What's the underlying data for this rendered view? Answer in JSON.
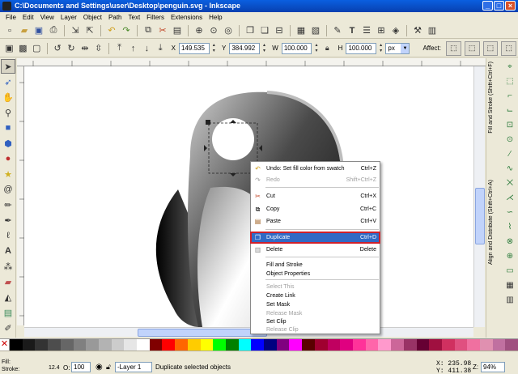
{
  "window": {
    "title": "C:\\Documents and Settings\\user\\Desktop\\penguin.svg - Inkscape"
  },
  "menubar": [
    "File",
    "Edit",
    "View",
    "Layer",
    "Object",
    "Path",
    "Text",
    "Filters",
    "Extensions",
    "Help"
  ],
  "toolbar1": {
    "icons": [
      "new-document-icon",
      "open-icon",
      "save-icon",
      "print-icon",
      "import-icon",
      "export-icon",
      "undo-icon",
      "redo-icon",
      "copy-icon",
      "cut-icon",
      "paste-icon",
      "zoom-selection-icon",
      "zoom-drawing-icon",
      "zoom-page-icon",
      "duplicate-icon",
      "clone-icon",
      "unlink-clone-icon",
      "group-icon",
      "ungroup-icon",
      "fill-stroke-icon",
      "text-tool-icon",
      "layers-icon",
      "align-icon",
      "xml-editor-icon",
      "preferences-icon",
      "document-properties-icon"
    ]
  },
  "toolbar2": {
    "x_label": "X",
    "x_value": "149.535",
    "y_label": "Y",
    "y_value": "384.992",
    "w_label": "W",
    "w_value": "100.000",
    "h_label": "H",
    "h_value": "100.000",
    "unit": "px",
    "affect_label": "Affect:"
  },
  "context_menu": {
    "items": [
      {
        "label": "Undo: Set fill color from swatch",
        "shortcut": "Ctrl+Z",
        "icon": "undo-icon",
        "enabled": true
      },
      {
        "label": "Redo",
        "shortcut": "Shift+Ctrl+Z",
        "icon": "redo-icon",
        "enabled": false
      },
      {
        "label": "Cut",
        "shortcut": "Ctrl+X",
        "icon": "cut-icon",
        "enabled": true
      },
      {
        "label": "Copy",
        "shortcut": "Ctrl+C",
        "icon": "copy-icon",
        "enabled": true
      },
      {
        "label": "Paste",
        "shortcut": "Ctrl+V",
        "icon": "paste-icon",
        "enabled": true
      },
      {
        "label": "Duplicate",
        "shortcut": "Ctrl+D",
        "icon": "duplicate-icon",
        "enabled": true,
        "highlighted": true
      },
      {
        "label": "Delete",
        "shortcut": "Delete",
        "icon": "delete-icon",
        "enabled": true
      },
      {
        "label": "Fill and Stroke",
        "shortcut": "",
        "enabled": true
      },
      {
        "label": "Object Properties",
        "shortcut": "",
        "enabled": true
      },
      {
        "label": "Select This",
        "shortcut": "",
        "enabled": false
      },
      {
        "label": "Create Link",
        "shortcut": "",
        "enabled": true
      },
      {
        "label": "Set Mask",
        "shortcut": "",
        "enabled": true
      },
      {
        "label": "Release Mask",
        "shortcut": "",
        "enabled": false
      },
      {
        "label": "Set Clip",
        "shortcut": "",
        "enabled": true
      },
      {
        "label": "Release Clip",
        "shortcut": "",
        "enabled": false
      }
    ]
  },
  "dock": {
    "tab1": "Fill and Stroke (Shift+Ctrl+F)",
    "tab2": "Align and Distribute (Shift+Ctrl+A)"
  },
  "palette": [
    "#000000",
    "#1a1a1a",
    "#333333",
    "#4d4d4d",
    "#666666",
    "#808080",
    "#999999",
    "#b3b3b3",
    "#cccccc",
    "#e6e6e6",
    "#ffffff",
    "#800000",
    "#ff0000",
    "#ff6600",
    "#ffcc00",
    "#ffff00",
    "#00ff00",
    "#008000",
    "#00ffff",
    "#0000ff",
    "#000080",
    "#800080",
    "#ff00ff",
    "#5a0000",
    "#a00030",
    "#c00060",
    "#e00080",
    "#ff3399",
    "#ff66aa",
    "#ff99cc",
    "#cc6699",
    "#993366",
    "#660033",
    "#a01040",
    "#d03060",
    "#e05080",
    "#f070a0",
    "#e090b0",
    "#c070a0",
    "#a05080"
  ],
  "status": {
    "fill_label": "Fill:",
    "stroke_label": "Stroke:",
    "stroke_value": "12.4",
    "opacity_label": "O:",
    "opacity_value": "100",
    "layer": "-Layer 1",
    "message": "Duplicate selected objects",
    "x": "X: 235.98",
    "y": "Y: 411.38",
    "zoom_label": "Z:",
    "zoom_value": "94%"
  }
}
